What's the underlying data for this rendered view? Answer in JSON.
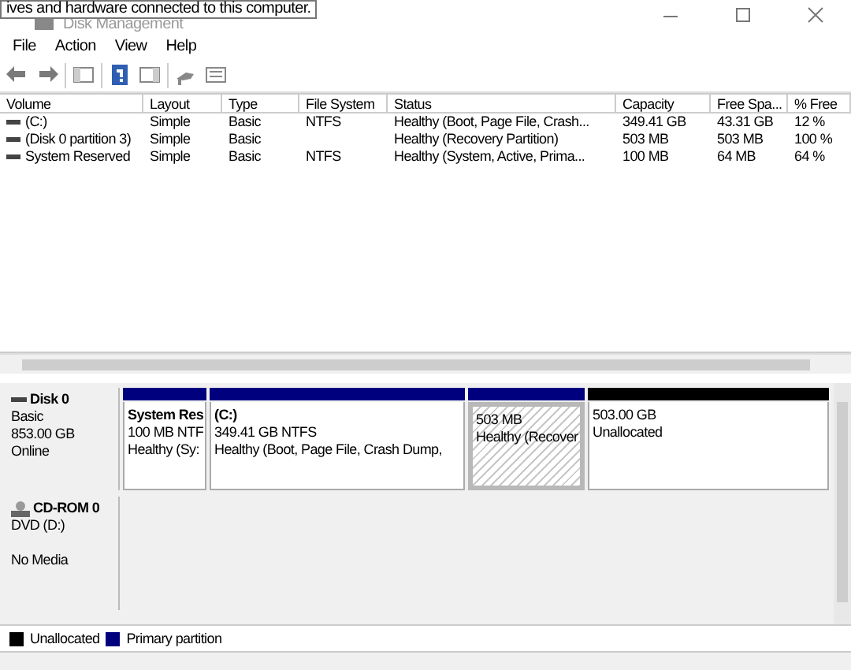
{
  "tooltip": "ives and hardware connected to this computer.",
  "window": {
    "title": "Disk Management"
  },
  "menu": [
    "File",
    "Action",
    "View",
    "Help"
  ],
  "volumes": {
    "columns": [
      "Volume",
      "Layout",
      "Type",
      "File System",
      "Status",
      "Capacity",
      "Free Spa...",
      "% Free"
    ],
    "rows": [
      [
        "(C:)",
        "Simple",
        "Basic",
        "NTFS",
        "Healthy (Boot, Page File, Crash...",
        "349.41 GB",
        "43.31 GB",
        "12 %"
      ],
      [
        "(Disk 0 partition 3)",
        "Simple",
        "Basic",
        "",
        "Healthy (Recovery Partition)",
        "503 MB",
        "503 MB",
        "100 %"
      ],
      [
        "System Reserved",
        "Simple",
        "Basic",
        "NTFS",
        "Healthy (System, Active, Prima...",
        "100 MB",
        "64 MB",
        "64 %"
      ]
    ]
  },
  "disks": [
    {
      "kind": "disk",
      "name": "Disk 0",
      "lines": [
        "Basic",
        "853.00 GB",
        "Online"
      ],
      "partitions": [
        {
          "name": "System Res",
          "lines": [
            "100 MB NTF",
            "Healthy (Sy:"
          ],
          "color": "#00007f",
          "selected": false
        },
        {
          "name": "(C:)",
          "lines": [
            "349.41 GB NTFS",
            "Healthy (Boot, Page File, Crash Dump,"
          ],
          "color": "#00007f",
          "selected": false
        },
        {
          "lines": [
            "503 MB",
            "Healthy (Recover"
          ],
          "color": "#00007f",
          "selected": true
        },
        {
          "lines": [
            "503.00 GB",
            "Unallocated"
          ],
          "color": "#000000",
          "selected": false
        }
      ]
    },
    {
      "kind": "cdrom",
      "name": "CD-ROM 0",
      "lines": [
        "DVD (D:)",
        "No Media"
      ]
    }
  ],
  "legend": [
    {
      "label": "Unallocated",
      "color": "#000000"
    },
    {
      "label": "Primary partition",
      "color": "#00007f"
    }
  ]
}
